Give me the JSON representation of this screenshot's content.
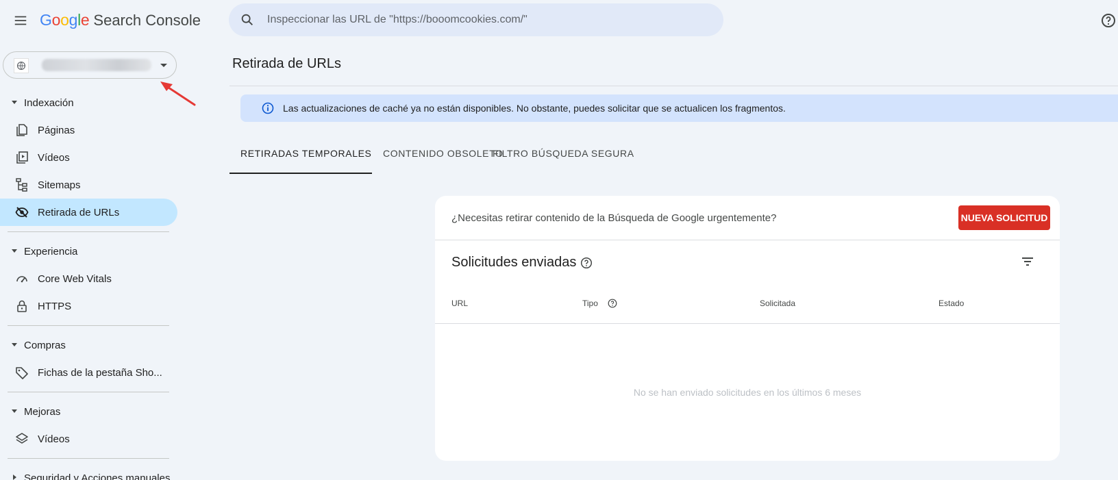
{
  "header": {
    "logo_google": [
      "G",
      "o",
      "o",
      "g",
      "l",
      "e"
    ],
    "logo_colors": [
      "#4285f4",
      "#ea4335",
      "#fbbc05",
      "#4285f4",
      "#34a853",
      "#ea4335"
    ],
    "product": "Search Console",
    "search_placeholder": "Inspeccionar las URL de \"https://booomcookies.com/\""
  },
  "sidebar": {
    "sections": [
      {
        "label": "Indexación",
        "items": [
          "Páginas",
          "Vídeos",
          "Sitemaps",
          "Retirada de URLs"
        ]
      },
      {
        "label": "Experiencia",
        "items": [
          "Core Web Vitals",
          "HTTPS"
        ]
      },
      {
        "label": "Compras",
        "items": [
          "Fichas de la pestaña Sho..."
        ]
      },
      {
        "label": "Mejoras",
        "items": [
          "Vídeos"
        ]
      },
      {
        "label": "Seguridad y Acciones manuales",
        "items": []
      }
    ],
    "active_item": "Retirada de URLs"
  },
  "main": {
    "title": "Retirada de URLs",
    "banner": "Las actualizaciones de caché ya no están disponibles. No obstante, puedes solicitar que se actualicen los fragmentos.",
    "tabs": [
      "RETIRADAS TEMPORALES",
      "CONTENIDO OBSOLETO",
      "FILTRO BÚSQUEDA SEGURA"
    ],
    "active_tab": "RETIRADAS TEMPORALES",
    "card": {
      "question": "¿Necesitas retirar contenido de la Búsqueda de Google urgentemente?",
      "new_request_label": "NUEVA SOLICITUD",
      "sent_title": "Solicitudes enviadas",
      "columns": [
        "URL",
        "Tipo",
        "Solicitada",
        "Estado"
      ],
      "empty_message": "No se han enviado solicitudes en los últimos 6 meses"
    }
  },
  "colors": {
    "accent_active": "#c2e7ff",
    "button_red": "#d93025",
    "banner_bg": "#d3e3fd",
    "annotation_arrow": "#e53935"
  }
}
